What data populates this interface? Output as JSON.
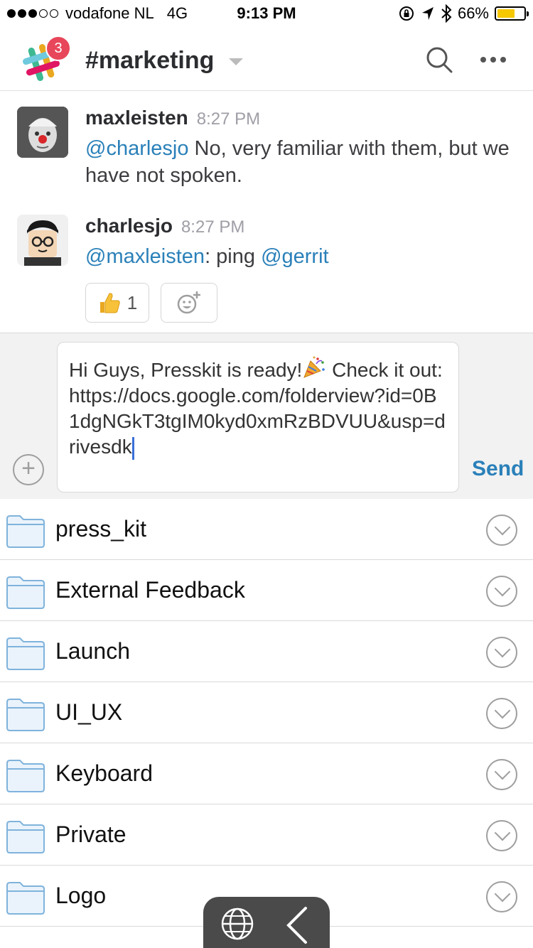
{
  "status_bar": {
    "carrier": "vodafone NL",
    "network": "4G",
    "time": "9:13 PM",
    "battery": "66%",
    "battery_level": 0.66
  },
  "header": {
    "badge_count": "3",
    "channel": "#marketing"
  },
  "messages": [
    {
      "author": "maxleisten",
      "time": "8:27 PM",
      "mention": "@charlesjo",
      "text": " No, very familiar with them, but we have not spoken."
    },
    {
      "author": "charlesjo",
      "time": "8:27 PM",
      "mention1": "@maxleisten",
      "text": ": ping ",
      "mention2": "@gerrit",
      "reaction_count": "1"
    }
  ],
  "composer": {
    "text_before_emoji": "Hi Guys, Presskit is ready!",
    "text_after_emoji": " Check it out: https://docs.google.com/folderview?id=0B1dgNGkT3tgIM0kyd0xmRzBDVUU&usp=drivesdk",
    "send_label": "Send",
    "add_label": "+"
  },
  "folders": [
    {
      "label": "press_kit"
    },
    {
      "label": "External Feedback"
    },
    {
      "label": "Launch"
    },
    {
      "label": "UI_UX"
    },
    {
      "label": "Keyboard"
    },
    {
      "label": "Private"
    },
    {
      "label": "Logo"
    }
  ],
  "colors": {
    "mention": "#2a80b9",
    "badge": "#e8465a",
    "send": "#2a80b9",
    "folder_stroke": "#7fb3dc",
    "folder_fill": "#eaf3fb"
  }
}
